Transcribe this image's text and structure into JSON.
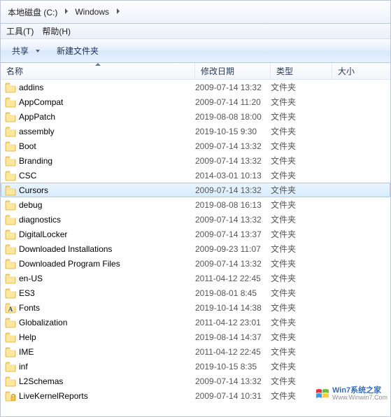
{
  "breadcrumb": {
    "root": "本地磁盘 (C:)",
    "folder": "Windows"
  },
  "menu": {
    "tools": "工具(T)",
    "help": "帮助(H)"
  },
  "command": {
    "share": "共享",
    "newfolder": "新建文件夹"
  },
  "columns": {
    "name": "名称",
    "date": "修改日期",
    "type": "类型",
    "size": "大小"
  },
  "type_folder": "文件夹",
  "selected": "Cursors",
  "items": [
    {
      "name": "addins",
      "date": "2009-07-14 13:32",
      "icon": "folder"
    },
    {
      "name": "AppCompat",
      "date": "2009-07-14 11:20",
      "icon": "folder"
    },
    {
      "name": "AppPatch",
      "date": "2019-08-08 18:00",
      "icon": "folder"
    },
    {
      "name": "assembly",
      "date": "2019-10-15 9:30",
      "icon": "folder"
    },
    {
      "name": "Boot",
      "date": "2009-07-14 13:32",
      "icon": "folder"
    },
    {
      "name": "Branding",
      "date": "2009-07-14 13:32",
      "icon": "folder"
    },
    {
      "name": "CSC",
      "date": "2014-03-01 10:13",
      "icon": "folder"
    },
    {
      "name": "Cursors",
      "date": "2009-07-14 13:32",
      "icon": "folder"
    },
    {
      "name": "debug",
      "date": "2019-08-08 16:13",
      "icon": "folder"
    },
    {
      "name": "diagnostics",
      "date": "2009-07-14 13:32",
      "icon": "folder"
    },
    {
      "name": "DigitalLocker",
      "date": "2009-07-14 13:37",
      "icon": "folder"
    },
    {
      "name": "Downloaded Installations",
      "date": "2009-09-23 11:07",
      "icon": "folder"
    },
    {
      "name": "Downloaded Program Files",
      "date": "2009-07-14 13:32",
      "icon": "folder"
    },
    {
      "name": "en-US",
      "date": "2011-04-12 22:45",
      "icon": "folder"
    },
    {
      "name": "ES3",
      "date": "2019-08-01 8:45",
      "icon": "folder"
    },
    {
      "name": "Fonts",
      "date": "2019-10-14 14:38",
      "icon": "fontfolder"
    },
    {
      "name": "Globalization",
      "date": "2011-04-12 23:01",
      "icon": "folder"
    },
    {
      "name": "Help",
      "date": "2019-08-14 14:37",
      "icon": "folder"
    },
    {
      "name": "IME",
      "date": "2011-04-12 22:45",
      "icon": "folder"
    },
    {
      "name": "inf",
      "date": "2019-10-15 8:35",
      "icon": "folder"
    },
    {
      "name": "L2Schemas",
      "date": "2009-07-14 13:32",
      "icon": "folder"
    },
    {
      "name": "LiveKernelReports",
      "date": "2009-07-14 10:31",
      "icon": "lockfolder"
    }
  ],
  "watermark": {
    "line1": "Win7系统之家",
    "line2": "Www.Winwin7.Com"
  }
}
